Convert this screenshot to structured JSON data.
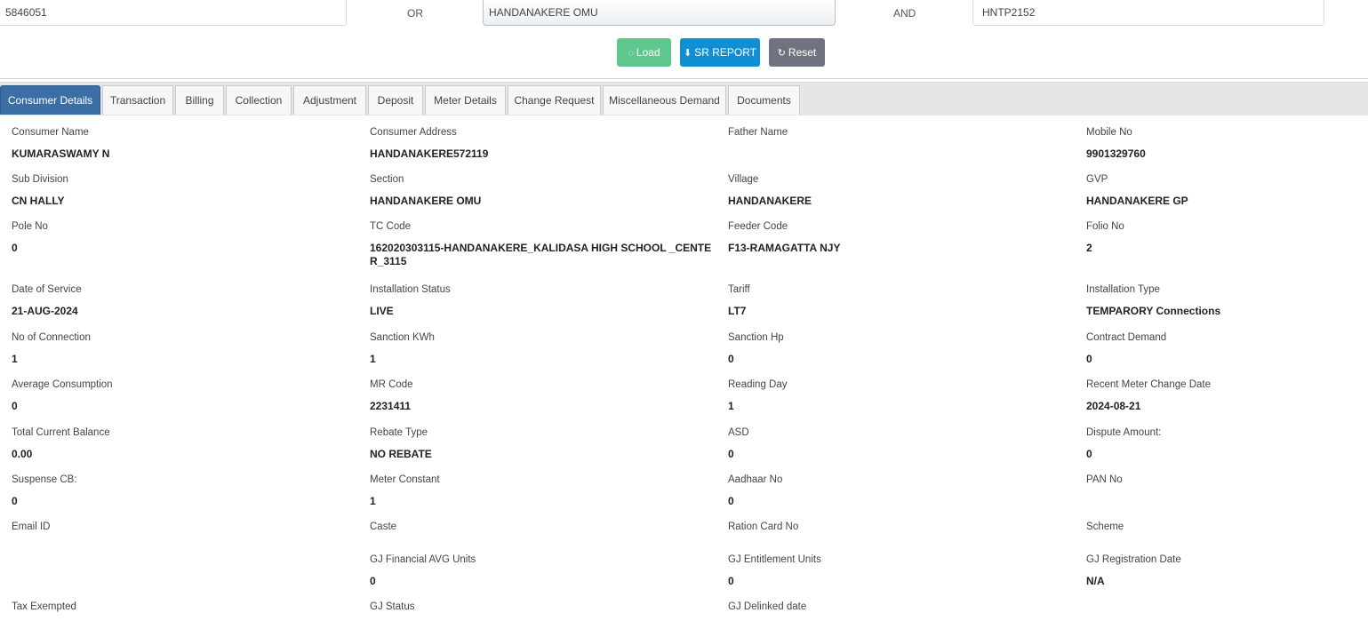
{
  "search": {
    "consumer_no": "5846051",
    "or_label": "OR",
    "section": "HANDANAKERE OMU",
    "and_label": "AND",
    "account": "HNTP2152"
  },
  "buttons": {
    "load": "Load",
    "sr_report": "SR REPORT",
    "reset": "Reset"
  },
  "tabs": [
    "Consumer Details",
    "Transaction",
    "Billing",
    "Collection",
    "Adjustment",
    "Deposit",
    "Meter Details",
    "Change Request",
    "Miscellaneous Demand",
    "Documents"
  ],
  "details": [
    {
      "label": "Consumer Name",
      "value": "KUMARASWAMY N"
    },
    {
      "label": "Consumer Address",
      "value": "HANDANAKERE572119"
    },
    {
      "label": "Father Name",
      "value": ""
    },
    {
      "label": "Mobile No",
      "value": "9901329760"
    },
    {
      "label": "Sub Division",
      "value": "CN HALLY"
    },
    {
      "label": "Section",
      "value": "HANDANAKERE OMU"
    },
    {
      "label": "Village",
      "value": "HANDANAKERE"
    },
    {
      "label": "GVP",
      "value": "HANDANAKERE GP"
    },
    {
      "label": "Pole No",
      "value": "0"
    },
    {
      "label": "TC Code",
      "value": "162020303115-HANDANAKERE_KALIDASA HIGH SCHOOL _CENTER_3115"
    },
    {
      "label": "Feeder Code",
      "value": "F13-RAMAGATTA NJY"
    },
    {
      "label": "Folio No",
      "value": "2"
    },
    {
      "label": "Date of Service",
      "value": "21-AUG-2024"
    },
    {
      "label": "Installation Status",
      "value": "LIVE"
    },
    {
      "label": "Tariff",
      "value": "LT7"
    },
    {
      "label": "Installation Type",
      "value": "TEMPARORY Connections"
    },
    {
      "label": "No of Connection",
      "value": "1"
    },
    {
      "label": "Sanction KWh",
      "value": "1"
    },
    {
      "label": "Sanction Hp",
      "value": "0"
    },
    {
      "label": "Contract Demand",
      "value": "0"
    },
    {
      "label": "Average Consumption",
      "value": "0"
    },
    {
      "label": "MR Code",
      "value": "2231411"
    },
    {
      "label": "Reading Day",
      "value": "1"
    },
    {
      "label": "Recent Meter Change Date",
      "value": "2024-08-21"
    },
    {
      "label": "Total Current Balance",
      "value": "0.00"
    },
    {
      "label": "Rebate Type",
      "value": "NO REBATE"
    },
    {
      "label": "ASD",
      "value": "0"
    },
    {
      "label": "Dispute Amount:",
      "value": "0"
    },
    {
      "label": "Suspense CB:",
      "value": "0"
    },
    {
      "label": "Meter Constant",
      "value": "1"
    },
    {
      "label": "Aadhaar No",
      "value": "0"
    },
    {
      "label": "PAN No",
      "value": ""
    },
    {
      "label": "Email ID",
      "value": ""
    },
    {
      "label": "Caste",
      "value": ""
    },
    {
      "label": "Ration Card No",
      "value": ""
    },
    {
      "label": "Scheme",
      "value": ""
    },
    {
      "label": "GJ Financial AVG Units",
      "value": "0"
    },
    {
      "label": "GJ Entitlement Units",
      "value": "0"
    },
    {
      "label": "GJ Registration Date",
      "value": "N/A"
    },
    {
      "label": "Tax Exempted",
      "value": ""
    },
    {
      "label": "GJ Status",
      "value": ""
    },
    {
      "label": "GJ Delinked date",
      "value": ""
    }
  ]
}
